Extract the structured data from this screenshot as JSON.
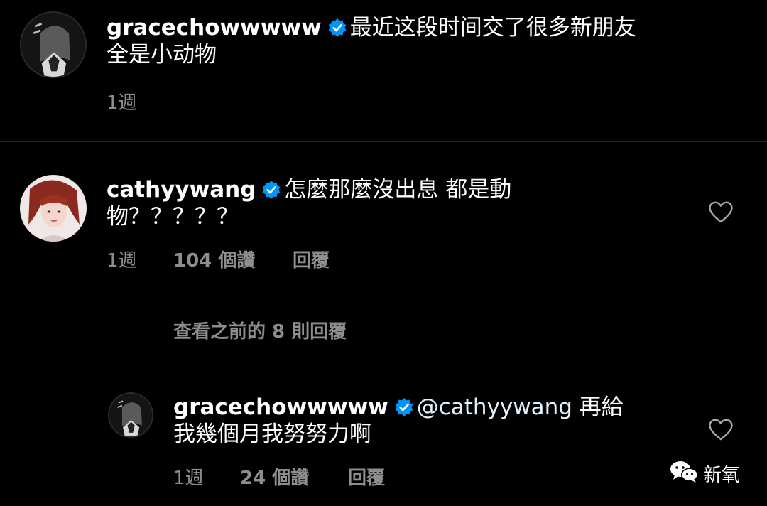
{
  "comments": [
    {
      "username": "gracechowwwww",
      "text_lines": [
        "最近这段时间交了很多新朋友",
        "全是小动物"
      ],
      "time": "1週"
    },
    {
      "username": "cathyywang",
      "text_lines": [
        "怎麼那麼沒出息 都是動",
        "物？？？？？"
      ],
      "time": "1週",
      "likes": "104 個讚",
      "reply_label": "回覆",
      "view_replies": "查看之前的 8 則回覆"
    }
  ],
  "reply": {
    "username": "gracechowwwww",
    "mention": "@cathyywang",
    "text_line1_rest": " 再給",
    "text_line2": "我幾個月我努努力啊",
    "time": "1週",
    "likes": "24 個讚",
    "reply_label": "回覆"
  },
  "watermark": {
    "text": "新氧",
    "icon": "wechat-icon"
  },
  "colors": {
    "background": "#000000",
    "text": "#ffffff",
    "meta": "#8e8e8e",
    "verified": "#0095f6",
    "divider": "#262626"
  }
}
